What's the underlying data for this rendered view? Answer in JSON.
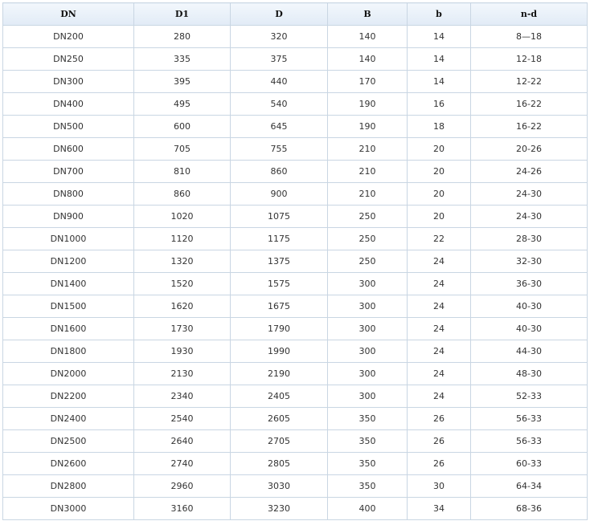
{
  "table": {
    "headers": [
      "DN",
      "D1",
      "D",
      "B",
      "b",
      "n-d"
    ],
    "rows": [
      [
        "DN200",
        "280",
        "320",
        "140",
        "14",
        "8—18"
      ],
      [
        "DN250",
        "335",
        "375",
        "140",
        "14",
        "12-18"
      ],
      [
        "DN300",
        "395",
        "440",
        "170",
        "14",
        "12-22"
      ],
      [
        "DN400",
        "495",
        "540",
        "190",
        "16",
        "16-22"
      ],
      [
        "DN500",
        "600",
        "645",
        "190",
        "18",
        "16-22"
      ],
      [
        "DN600",
        "705",
        "755",
        "210",
        "20",
        "20-26"
      ],
      [
        "DN700",
        "810",
        "860",
        "210",
        "20",
        "24-26"
      ],
      [
        "DN800",
        "860",
        "900",
        "210",
        "20",
        "24-30"
      ],
      [
        "DN900",
        "1020",
        "1075",
        "250",
        "20",
        "24-30"
      ],
      [
        "DN1000",
        "1120",
        "1175",
        "250",
        "22",
        "28-30"
      ],
      [
        "DN1200",
        "1320",
        "1375",
        "250",
        "24",
        "32-30"
      ],
      [
        "DN1400",
        "1520",
        "1575",
        "300",
        "24",
        "36-30"
      ],
      [
        "DN1500",
        "1620",
        "1675",
        "300",
        "24",
        "40-30"
      ],
      [
        "DN1600",
        "1730",
        "1790",
        "300",
        "24",
        "40-30"
      ],
      [
        "DN1800",
        "1930",
        "1990",
        "300",
        "24",
        "44-30"
      ],
      [
        "DN2000",
        "2130",
        "2190",
        "300",
        "24",
        "48-30"
      ],
      [
        "DN2200",
        "2340",
        "2405",
        "300",
        "24",
        "52-33"
      ],
      [
        "DN2400",
        "2540",
        "2605",
        "350",
        "26",
        "56-33"
      ],
      [
        "DN2500",
        "2640",
        "2705",
        "350",
        "26",
        "56-33"
      ],
      [
        "DN2600",
        "2740",
        "2805",
        "350",
        "26",
        "60-33"
      ],
      [
        "DN2800",
        "2960",
        "3030",
        "350",
        "30",
        "64-34"
      ],
      [
        "DN3000",
        "3160",
        "3230",
        "400",
        "34",
        "68-36"
      ]
    ]
  },
  "colors": {
    "border": "#c9d6e3",
    "header_bg": "#e1ebf6",
    "text": "#333333"
  }
}
